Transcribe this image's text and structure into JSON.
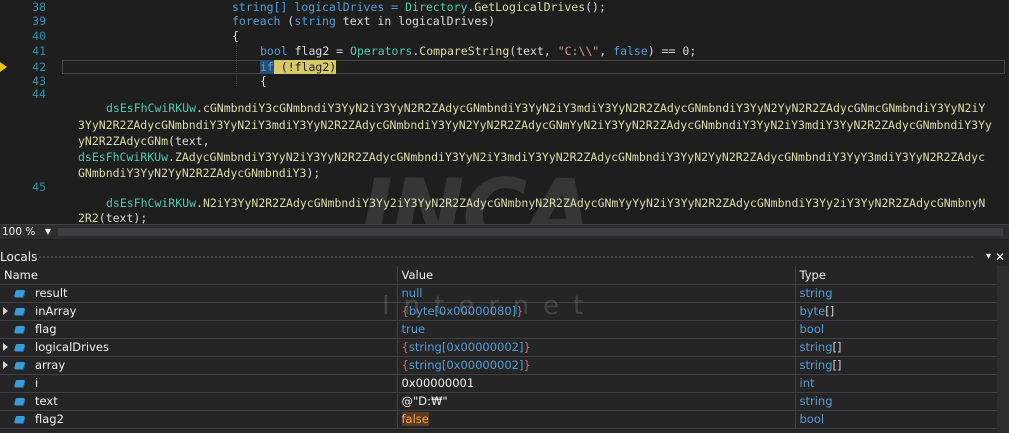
{
  "editor": {
    "line_numbers": [
      "38",
      "39",
      "40",
      "41",
      "42",
      "43",
      "44",
      "45"
    ],
    "lines": [
      {
        "pre": "string[] logicalDrives = ",
        "t": "Directory",
        "dot": ".",
        "m": "GetLogicalDrives",
        "post": "();"
      },
      {
        "k": "foreach",
        "pre": " (",
        "k2": "string",
        "post": " text in logicalDrives)"
      },
      {
        "text": "{"
      },
      {
        "k": "bool",
        "pre": " flag2 = ",
        "t": "Operators",
        "dot": ".",
        "m": "CompareString",
        "post1": "(text, ",
        "s": "\"C:\\\\\"",
        "post2": ", ",
        "k2": "false",
        "post3": ") == 0;"
      },
      {
        "k": "if",
        "post": " (!flag2)"
      },
      {
        "text": "{"
      }
    ],
    "obfuscated": [
      {
        "obj": "dsEsFhCwiRKUw",
        "mem": ".cGNmbndiY3cGNmbndiY3YyN2iY3YyN2R2ZAdycGNmbndiY3YyN2iY3mdiY3YyN2R2ZAdycGNmbndiY3YyN2YyN2R2ZAdycGNmcGNmbndiY3YyN2iY",
        "cont1": "3YyN2R2ZAdycGNmbndiY3YyN2iY3mdiY3YyN2R2ZAdycGNmbndiY3YyN2YyN2R2ZAdycGNmYyN2iY3YyN2R2ZAdycGNmbndiY3YyN2iY3mdiY3YyN2R2ZAdycGNmbndiY3Yy",
        "cont2": "yN2R2ZAdycGNm",
        "tail": "(text,"
      },
      {
        "obj": "dsEsFhCwiRKUw",
        "mem": ".ZAdycGNmbndiY3YyN2iY3YyN2R2ZAdycGNmbndiY3YyN2iY3mdiY3YyN2R2ZAdycGNmbndiY3YyN2YyN2R2ZAdycGNmbndiY3YyY3mdiY3YyN2R2ZAdyc",
        "cont1": "GNmbndiY3YyN2YyN2R2ZAdycGNmbndiY3",
        "tail": ");"
      },
      {
        "obj": "dsEsFhCwiRKUw",
        "mem": ".N2iY3YyN2R2ZAdycGNmbndiY3Yy2iY3YyN2R2ZAdycGNmbnyN2R2ZAdycGNmYyYyN2iY3YyN2R2ZAdycGNmbndiY3Yy2iY3YyN2R2ZAdycGNmbnyN",
        "cont1": "2R2",
        "tail": "(text);"
      }
    ],
    "watermark_main": "INCA",
    "watermark_sub": "Internet"
  },
  "statusbar": {
    "zoom": "100 %"
  },
  "locals": {
    "title": "Locals",
    "columns": [
      "Name",
      "Value",
      "Type"
    ],
    "rows": [
      {
        "name": "result",
        "value": "null",
        "type": "string",
        "expandable": false,
        "style": "blue",
        "tstyle": "c"
      },
      {
        "name": "inArray",
        "value": "byte[0x00000080]",
        "type": "byte[]",
        "expandable": true,
        "style": "brace",
        "tstyle": "c"
      },
      {
        "name": "flag",
        "value": "true",
        "type": "bool",
        "expandable": false,
        "style": "blue",
        "tstyle": "c"
      },
      {
        "name": "logicalDrives",
        "value": "string[0x00000002]",
        "type": "string[]",
        "expandable": true,
        "style": "brace",
        "tstyle": "c"
      },
      {
        "name": "array",
        "value": "string[0x00000002]",
        "type": "string[]",
        "expandable": true,
        "style": "brace",
        "tstyle": "c"
      },
      {
        "name": "i",
        "value": "0x00000001",
        "type": "int",
        "expandable": false,
        "style": "plain",
        "tstyle": "c"
      },
      {
        "name": "text",
        "value": "@\"D:₩\"",
        "type": "string",
        "expandable": false,
        "style": "plain",
        "tstyle": "c"
      },
      {
        "name": "flag2",
        "value": "false",
        "type": "bool",
        "expandable": false,
        "style": "changed",
        "tstyle": "c"
      }
    ]
  },
  "colors": {
    "keyword": "#569cd6",
    "type": "#4ec9b0",
    "string": "#d69d85",
    "method": "#dcdcaa",
    "linenumber": "#2b91af"
  }
}
